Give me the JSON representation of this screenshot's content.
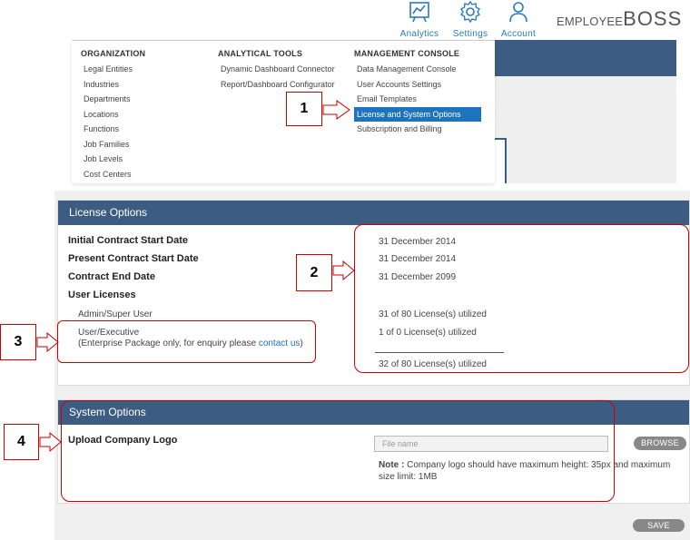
{
  "nav": {
    "items": [
      {
        "label": "Analytics",
        "icon": "analytics-icon"
      },
      {
        "label": "Settings",
        "icon": "gear-icon"
      },
      {
        "label": "Account",
        "icon": "user-icon"
      }
    ],
    "brand_small": "EMPLOYEE",
    "brand_big": "BOSS"
  },
  "menu": {
    "organization": {
      "heading": "ORGANIZATION",
      "items": [
        "Legal Entities",
        "Industries",
        "Departments",
        "Locations",
        "Functions",
        "Job Families",
        "Job Levels",
        "Cost Centers"
      ]
    },
    "analytical": {
      "heading": "ANALYTICAL TOOLS",
      "items": [
        "Dynamic Dashboard Connector",
        "Report/Dashboard Configurator"
      ]
    },
    "management": {
      "heading": "MANAGEMENT CONSOLE",
      "items": [
        "Data Management Console",
        "User Accounts Settings",
        "Email Templates",
        "License and System Options",
        "Subscription and Billing"
      ],
      "active": "License and System Options"
    }
  },
  "callouts": [
    "1",
    "2",
    "3",
    "4"
  ],
  "license": {
    "title": "License Options",
    "initial_start_label": "Initial Contract Start Date",
    "present_start_label": "Present Contract Start Date",
    "end_label": "Contract End Date",
    "user_licenses_label": "User Licenses",
    "admin_label": "Admin/Super User",
    "executive_label": "User/Executive",
    "executive_note_pre": "(Enterprise Package only, for enquiry please ",
    "executive_note_link": "contact us",
    "executive_note_post": ")",
    "initial_start_value": "31 December 2014",
    "present_start_value": "31 December 2014",
    "end_value": "31 December 2099",
    "admin_value": "31 of 80 License(s) utilized",
    "executive_value": "1 of 0 License(s) utilized",
    "total_value": "32 of 80 License(s) utilized"
  },
  "system": {
    "title": "System Options",
    "upload_label": "Upload Company Logo",
    "file_placeholder": "File name",
    "browse_label": "BROWSE",
    "note_label": "Note :",
    "note_text": " Company logo should have maximum height: 35px and maximum size limit: 1MB"
  },
  "save_label": "SAVE",
  "colors": {
    "header": "#3c5c82",
    "accent": "#1e73be",
    "callout_border": "#cc0000"
  }
}
